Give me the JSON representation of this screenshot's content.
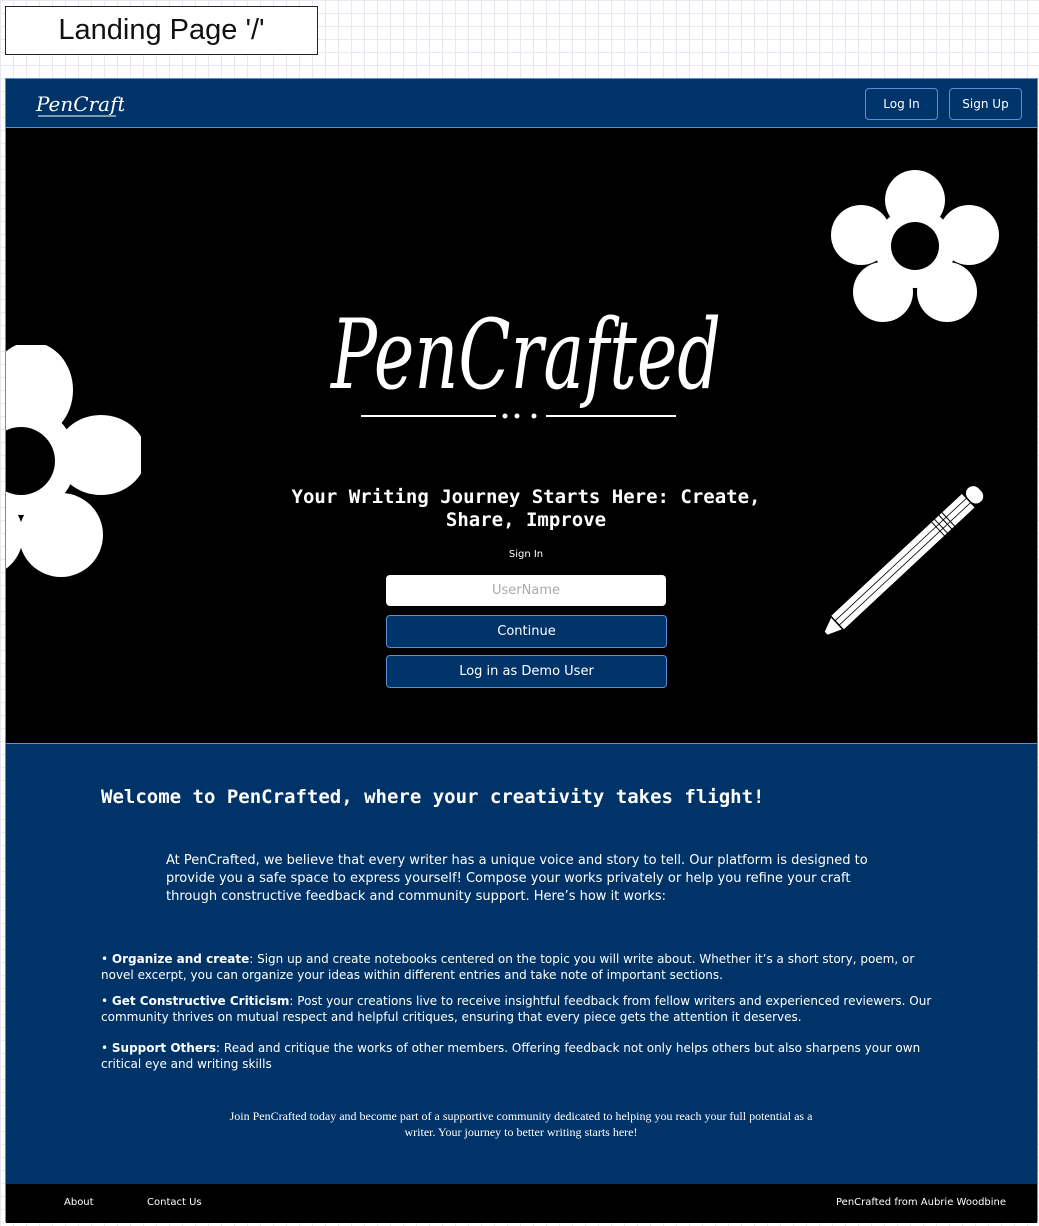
{
  "page_label": "Landing Page '/'",
  "nav": {
    "logo_text": "PenCrafted",
    "login_label": "Log In",
    "signup_label": "Sign Up"
  },
  "hero": {
    "logo_text": "PenCrafted",
    "tagline": "Your Writing Journey Starts Here: Create, Share, Improve",
    "signin_label": "Sign In",
    "username_placeholder": "UserName",
    "continue_label": "Continue",
    "demo_label": "Log in as Demo User"
  },
  "info": {
    "welcome": "Welcome to PenCrafted, where your creativity takes flight!",
    "intro": "At PenCrafted, we believe that every writer has a unique voice and story to tell. Our platform is designed to provide you a safe space to express yourself!  Compose your works privately or help you refine your craft through constructive feedback and community support. Here’s how it works:",
    "features": [
      {
        "title": "Organize and create",
        "text": ": Sign up and create notebooks centered on the topic you will write about. Whether it’s a short story, poem, or novel excerpt, you can organize your ideas within different entries and take note of important sections."
      },
      {
        "title": "Get Constructive Criticism",
        "text": ": Post your creations live to receive insightful feedback from fellow writers and experienced reviewers. Our community thrives on mutual respect and helpful critiques, ensuring that every piece gets the attention it deserves."
      },
      {
        "title": "Support Others",
        "text": ": Read and critique the works of other members. Offering feedback not only helps others but also sharpens your own critical eye and writing skills"
      }
    ],
    "join": "Join PenCrafted today and become part of a supportive community dedicated to helping you reach your full potential as a writer. Your journey to better writing starts here!"
  },
  "footer": {
    "about": "About",
    "contact": "Contact Us",
    "credit": "PenCrafted from Aubrie Woodbine"
  },
  "colors": {
    "navy": "#003368",
    "accent_border": "#5b8fd6",
    "hero_bg": "#000000"
  }
}
